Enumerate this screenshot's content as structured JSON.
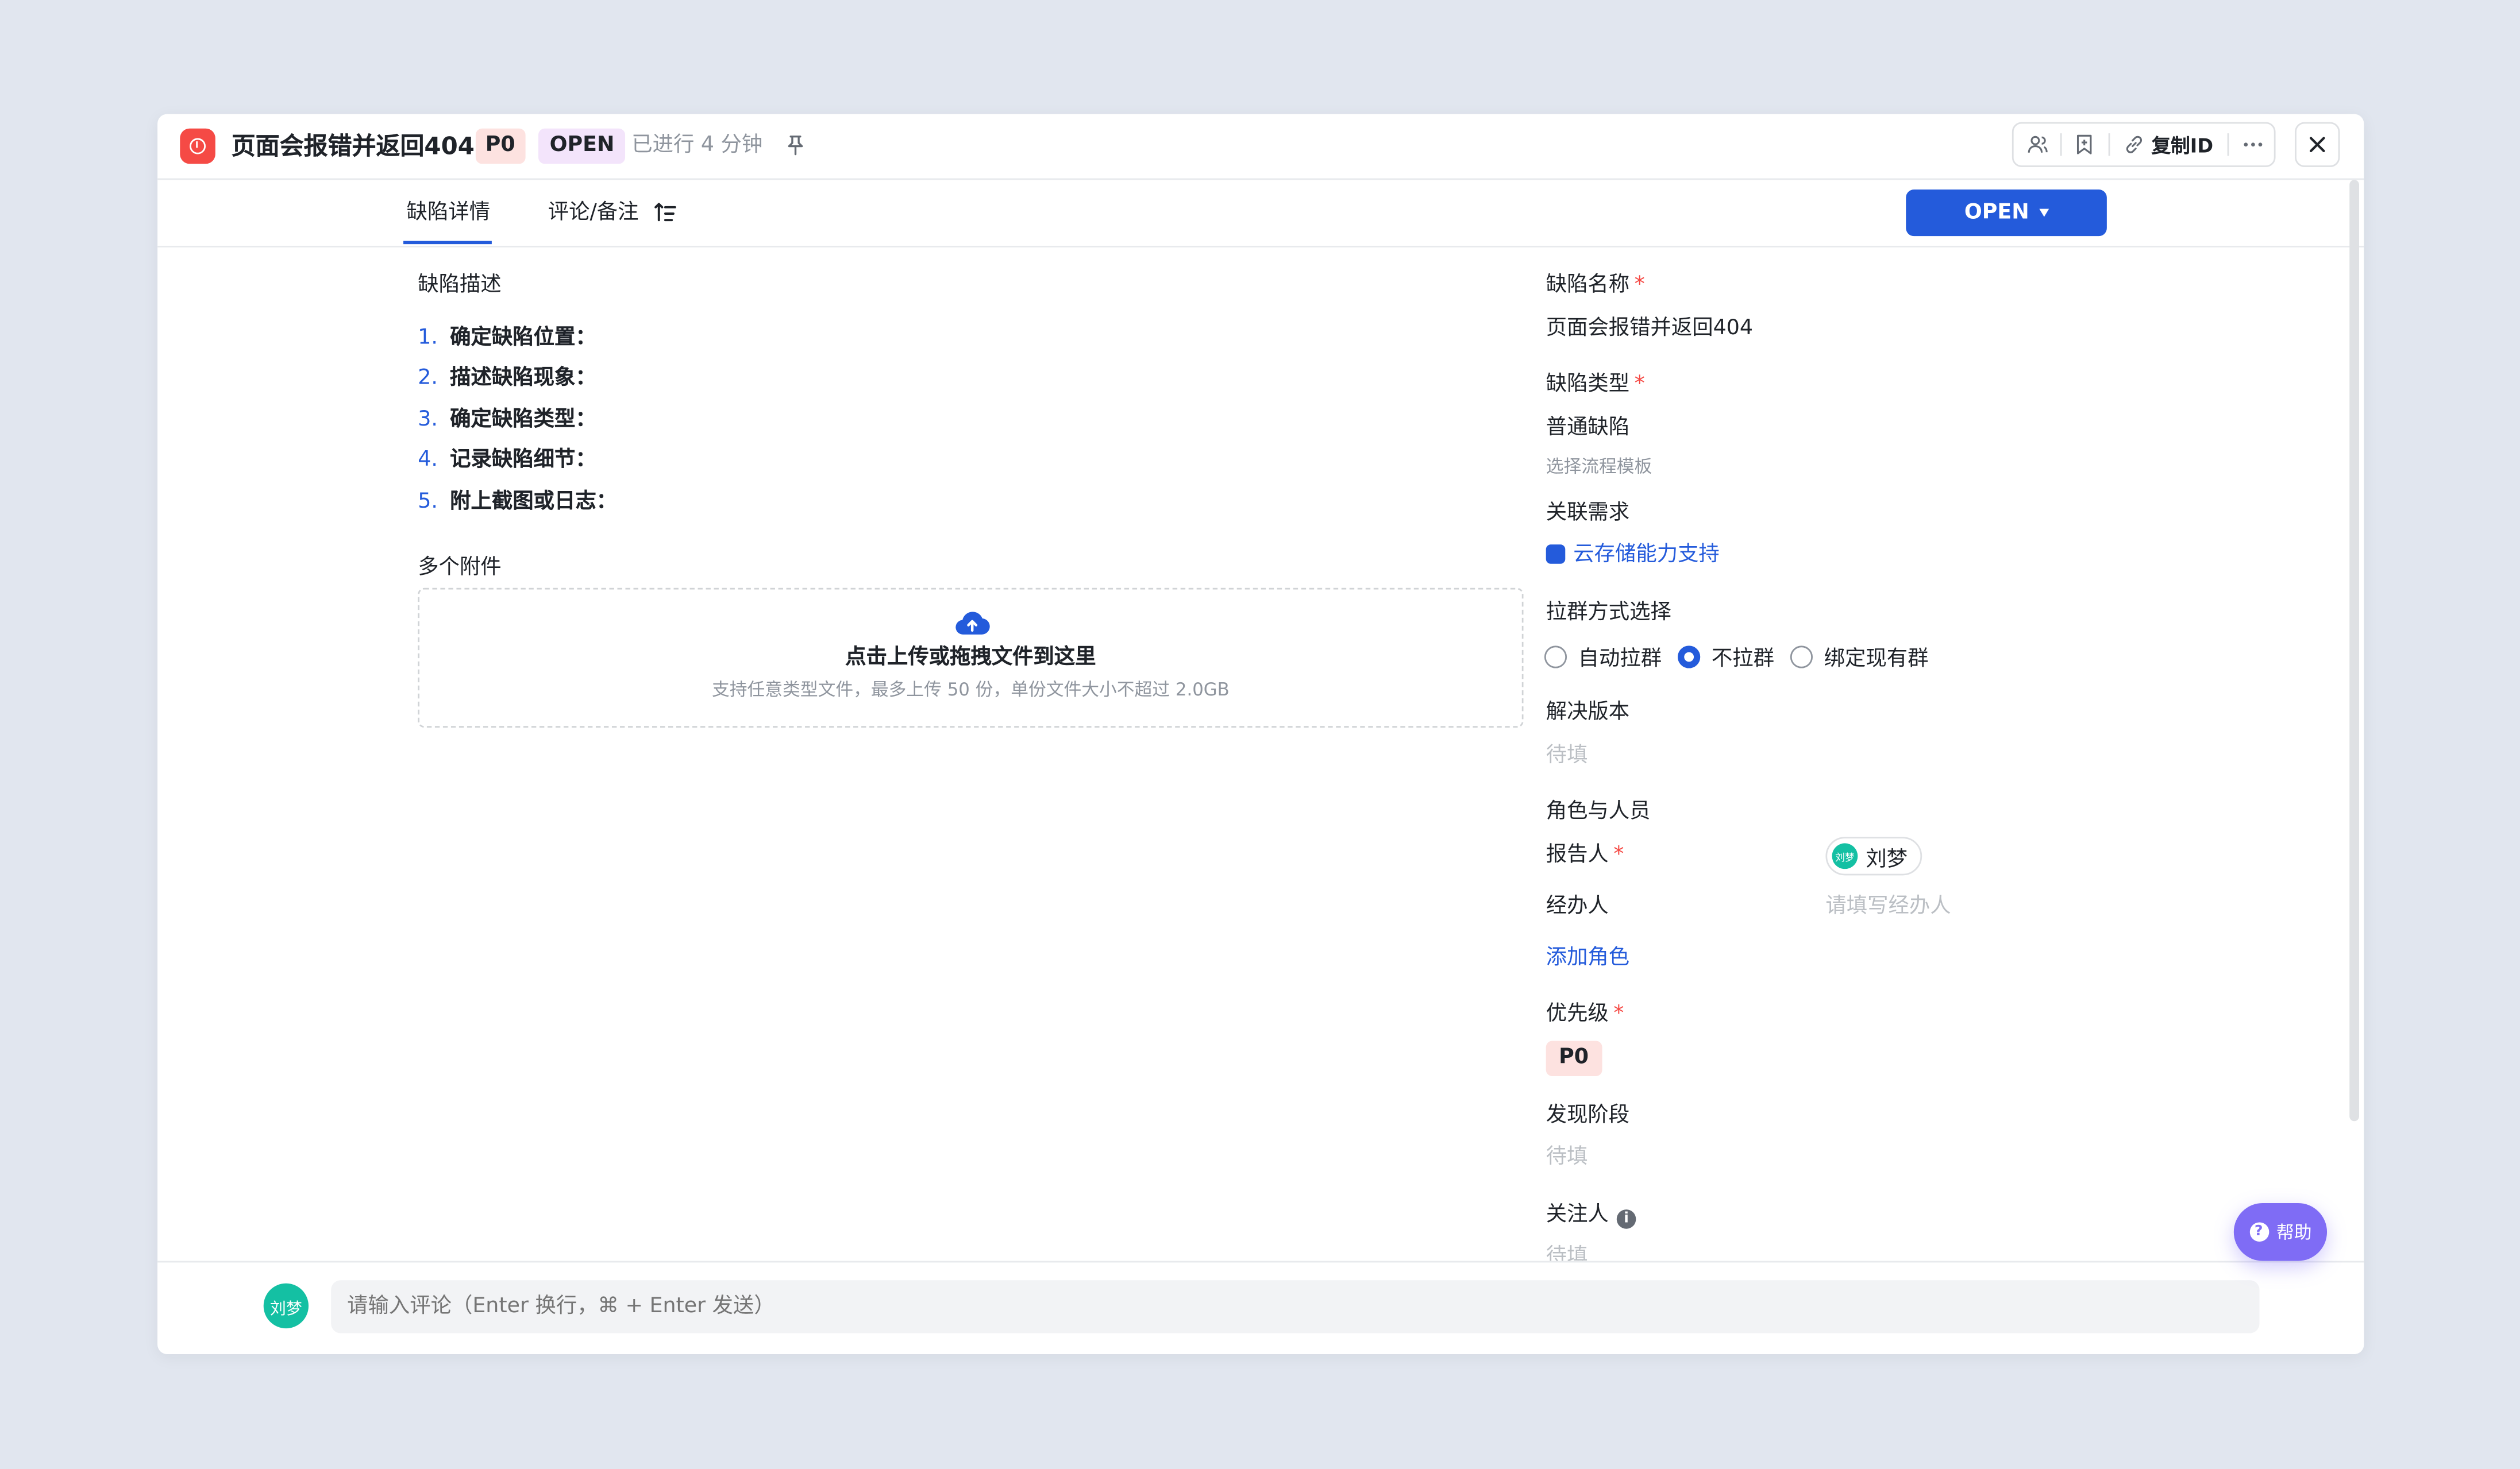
{
  "header": {
    "title": "页面会报错并返回404",
    "priority": "P0",
    "status": "OPEN",
    "elapsed": "已进行 4 分钟",
    "copy_id": "复制ID"
  },
  "tabs": [
    {
      "label": "缺陷详情",
      "active": true
    },
    {
      "label": "评论/备注",
      "active": false
    }
  ],
  "status_button": "OPEN",
  "description": {
    "label": "缺陷描述",
    "steps": [
      {
        "num": "1.",
        "text": "确定缺陷位置："
      },
      {
        "num": "2.",
        "text": "描述缺陷现象："
      },
      {
        "num": "3.",
        "text": "确定缺陷类型："
      },
      {
        "num": "4.",
        "text": "记录缺陷细节："
      },
      {
        "num": "5.",
        "text": "附上截图或日志："
      }
    ]
  },
  "attachments": {
    "label": "多个附件",
    "upload_title": "点击上传或拖拽文件到这里",
    "upload_hint": "支持任意类型文件，最多上传 50 份，单份文件大小不超过 2.0GB"
  },
  "fields": {
    "name_label": "缺陷名称",
    "name_value": "页面会报错并返回404",
    "type_label": "缺陷类型",
    "type_value": "普通缺陷",
    "template_hint": "选择流程模板",
    "related_label": "关联需求",
    "related_value": "云存储能力支持",
    "group_label": "拉群方式选择",
    "group_options": [
      "自动拉群",
      "不拉群",
      "绑定现有群"
    ],
    "group_selected": "不拉群",
    "version_label": "解决版本",
    "version_value": "待填",
    "roles_label": "角色与人员",
    "reporter_label": "报告人",
    "reporter_value": "刘梦",
    "assignee_label": "经办人",
    "assignee_placeholder": "请填写经办人",
    "add_role": "添加角色",
    "priority_label": "优先级",
    "priority_value": "P0",
    "phase_label": "发现阶段",
    "phase_value": "待填",
    "watchers_label": "关注人",
    "watchers_value": "待填"
  },
  "footer": {
    "avatar": "刘梦",
    "comment_placeholder": "请输入评论（Enter 换行，⌘ + Enter 发送）"
  },
  "help": "帮助",
  "colors": {
    "accent": "#245bdb",
    "danger": "#f54a45",
    "avatar": "#14c0a3",
    "help": "#7f6cf5"
  }
}
